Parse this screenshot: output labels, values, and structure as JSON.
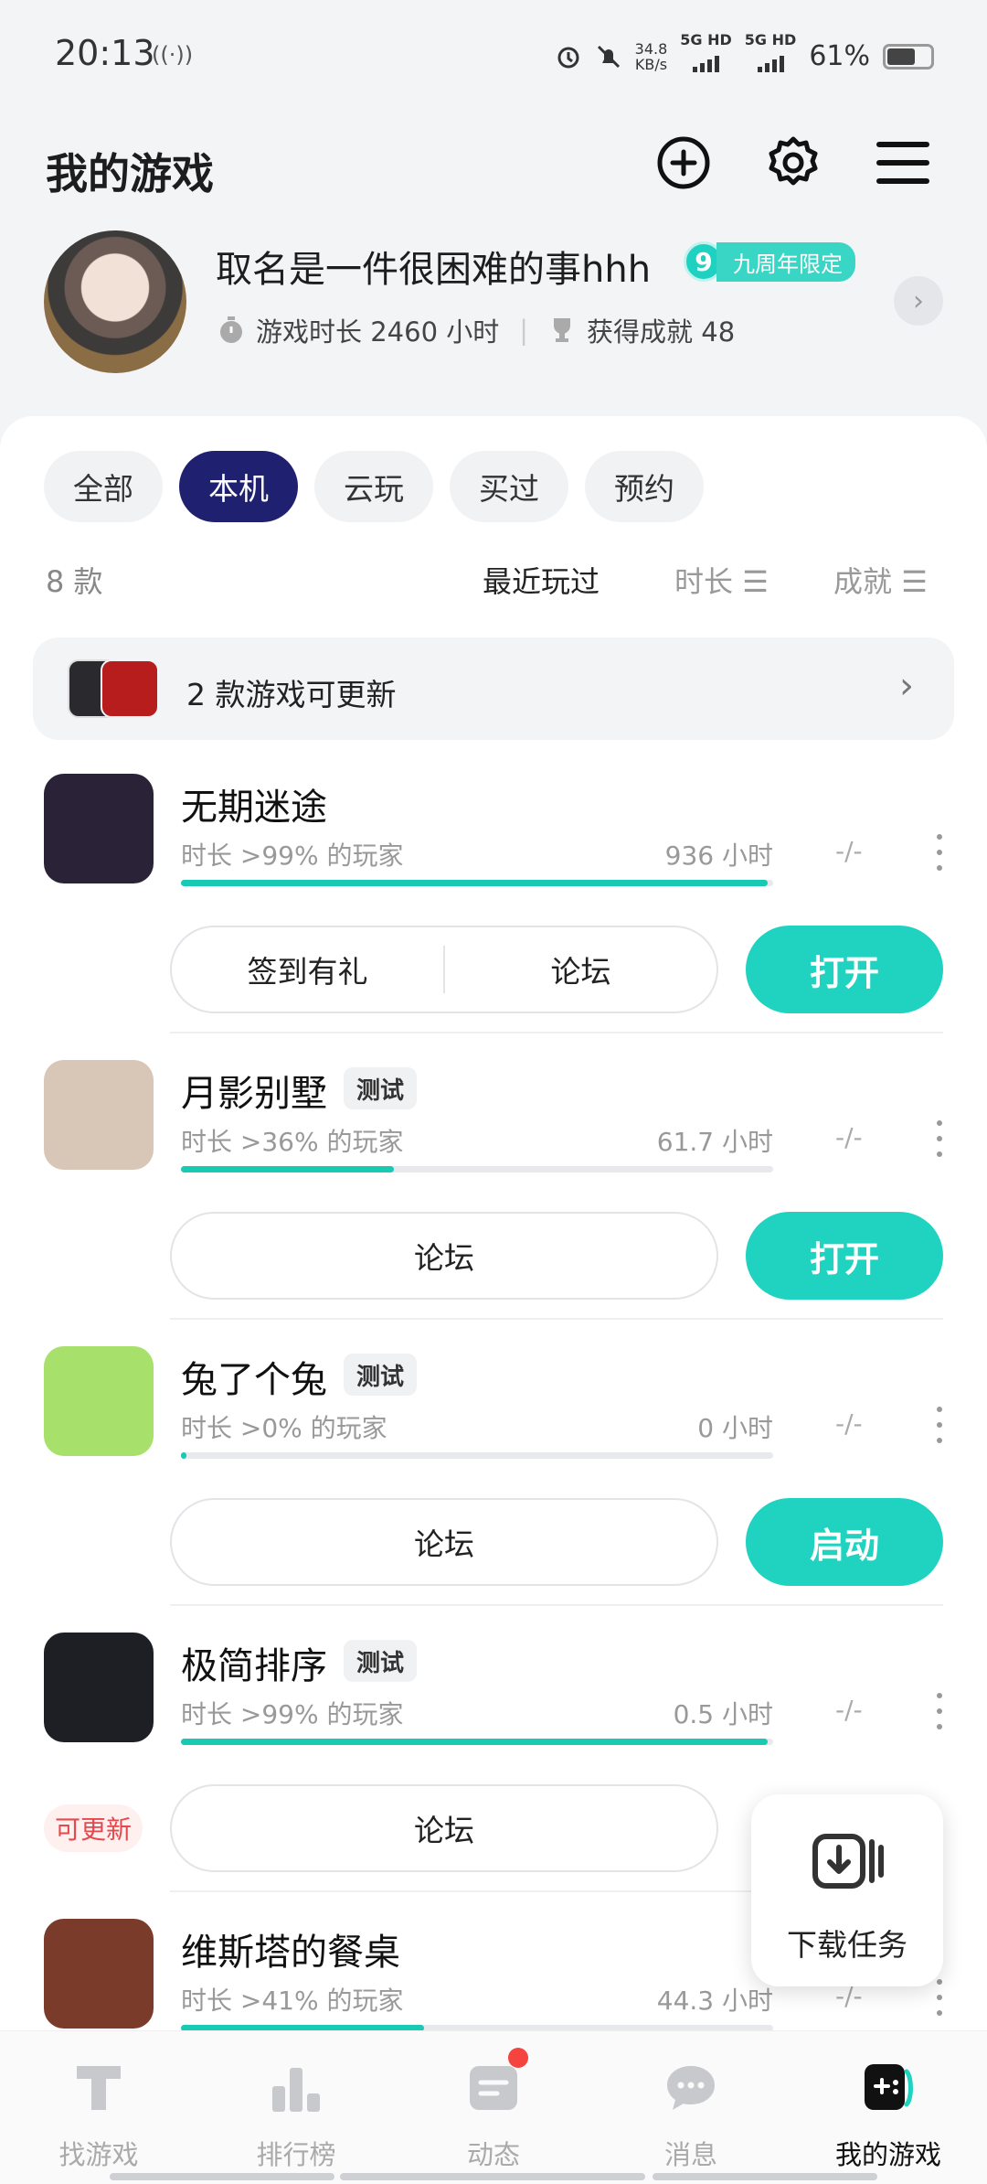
{
  "status_bar": {
    "time": "20:13",
    "radio": "((·))",
    "speed_value": "34.8",
    "speed_unit": "KB/s",
    "net1": "5G HD",
    "net2": "5G HD",
    "battery": "61%",
    "battery_level": 0.61
  },
  "header": {
    "title": "我的游戏",
    "add_icon": "plus-circle-icon",
    "settings_icon": "gear-icon",
    "menu_icon": "hamburger-menu-icon"
  },
  "profile": {
    "username": "取名是一件很困难的事hhh",
    "badge_number": "9",
    "badge_text": "九周年限定",
    "playtime": "游戏时长 2460 小时",
    "achievements": "获得成就 48"
  },
  "tabs": [
    "全部",
    "本机",
    "云玩",
    "买过",
    "预约"
  ],
  "active_tab": "本机",
  "list_header": {
    "count": "8 款",
    "sort_recent": "最近玩过",
    "sort_duration": "时长",
    "sort_achievement": "成就",
    "sort_icon": "sort-icon"
  },
  "update_banner": {
    "text": "2 款游戏可更新"
  },
  "games": [
    {
      "name": "无期迷途",
      "tag": "",
      "rank": "时长 >99% 的玩家",
      "hours": "936 小时",
      "achievement": "-/-",
      "progress": 0.99,
      "buttons": [
        "签到有礼",
        "论坛"
      ],
      "action": "打开",
      "update_label": "",
      "icon_color": "#2a2236"
    },
    {
      "name": "月影别墅",
      "tag": "测试",
      "rank": "时长 >36% 的玩家",
      "hours": "61.7 小时",
      "achievement": "-/-",
      "progress": 0.36,
      "buttons": [
        "论坛"
      ],
      "action": "打开",
      "update_label": "",
      "icon_color": "#d8c7b6"
    },
    {
      "name": "兔了个兔",
      "tag": "测试",
      "rank": "时长 >0% 的玩家",
      "hours": "0 小时",
      "achievement": "-/-",
      "progress": 0.0,
      "buttons": [
        "论坛"
      ],
      "action": "启动",
      "update_label": "",
      "icon_color": "#a7e06a"
    },
    {
      "name": "极简排序",
      "tag": "测试",
      "rank": "时长 >99% 的玩家",
      "hours": "0.5 小时",
      "achievement": "-/-",
      "progress": 0.99,
      "buttons": [
        "论坛"
      ],
      "action": "",
      "update_label": "可更新",
      "icon_color": "#1e1f24"
    },
    {
      "name": "维斯塔的餐桌",
      "tag": "",
      "rank": "时长 >41% 的玩家",
      "hours": "44.3 小时",
      "achievement": "-/-",
      "progress": 0.41,
      "buttons": [],
      "action": "",
      "update_label": "",
      "icon_color": "#7a3b2a"
    }
  ],
  "download_task": {
    "label": "下载任务",
    "icon": "download-task-icon"
  },
  "bottom_nav": [
    {
      "label": "找游戏",
      "icon": "find-game-icon"
    },
    {
      "label": "排行榜",
      "icon": "ranking-icon"
    },
    {
      "label": "动态",
      "icon": "feed-icon"
    },
    {
      "label": "消息",
      "icon": "message-icon"
    },
    {
      "label": "我的游戏",
      "icon": "my-games-icon"
    }
  ],
  "active_nav": "我的游戏",
  "colors": {
    "accent": "#1fd3c0",
    "active_tab": "#1f2070",
    "update_red": "#e5484d"
  }
}
